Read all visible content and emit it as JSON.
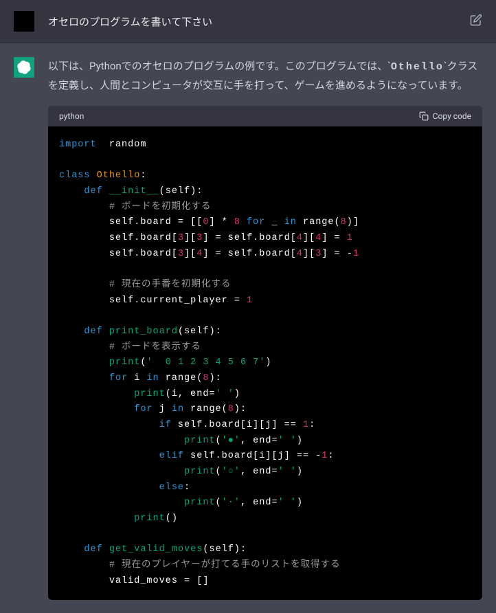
{
  "user": {
    "message": "オセロのプログラムを書いて下さい"
  },
  "assistant": {
    "response_pre": "以下は、Pythonでのオセロのプログラムの例です。このプログラムでは、",
    "response_code": "Othello",
    "response_post": "クラスを定義し、人間とコンピュータが交互に手を打って、ゲームを進めるようになっています。"
  },
  "code": {
    "language": "python",
    "copy_label": "Copy code",
    "tokens": {
      "import": "import",
      "random": "random",
      "class": "class",
      "othello": "Othello",
      "def": "def",
      "init": "__init__",
      "self": "self",
      "comment1": "# ボードを初期化する",
      "board_line": "self.board = [[",
      "zero": "0",
      "mult": "] * ",
      "eight": "8",
      "for_": " for",
      "underscore": " _ ",
      "in_": "in",
      "range_": " range(",
      "close_range": ")]",
      "sb33": "self.board[",
      "three": "3",
      "close_bracket": "][",
      "eq_sb": "] = self.board[",
      "four": "4",
      "eq_one": "] = ",
      "one": "1",
      "neg_one": "1",
      "comment2": "# 現在の手番を初期化する",
      "current_player": "self.current_player = ",
      "print_board": "print_board",
      "comment3": "# ボードを表示する",
      "print_": "print",
      "header_str": "'  0 1 2 3 4 5 6 7'",
      "for": "for",
      "i_var": " i ",
      "in": "in",
      "range": " range(",
      "close_paren": "):",
      "end_str": "(i, end=",
      "space_str": "' '",
      "j_var": " j ",
      "if_": "if",
      "board_ij": " self.board[i][j] == ",
      "colon": ":",
      "black_str": "'●'",
      "comma_end": ", end=",
      "elif_": "elif",
      "neg": " self.board[i][j] == -",
      "white_str": "'○'",
      "else_": "else",
      "dot_str": "'·'",
      "empty_paren": "()",
      "get_valid": "get_valid_moves",
      "comment4": "# 現在のプレイヤーが打てる手のリストを取得する",
      "valid_moves": "valid_moves = []"
    }
  }
}
